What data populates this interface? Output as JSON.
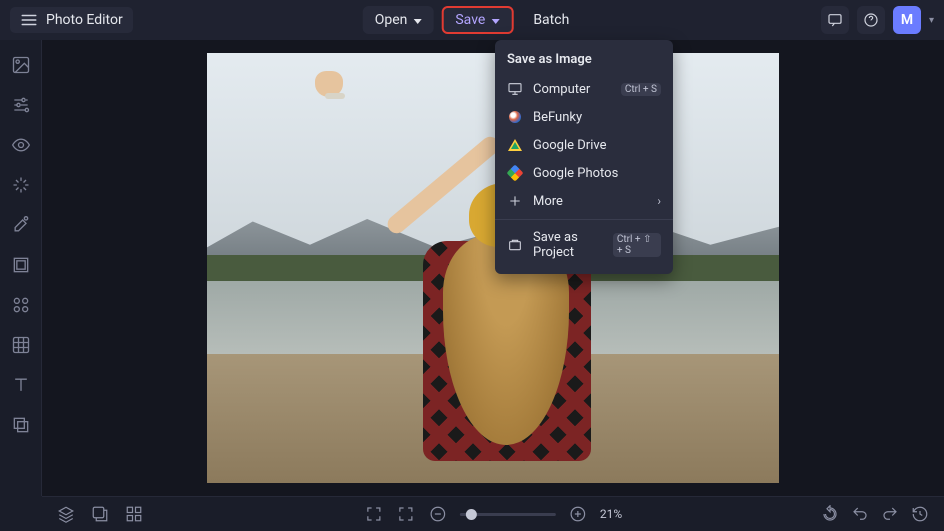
{
  "app_title": "Photo Editor",
  "header": {
    "open": "Open",
    "save": "Save",
    "batch": "Batch",
    "avatar_initial": "M"
  },
  "save_menu": {
    "title": "Save as Image",
    "items": [
      {
        "icon": "computer",
        "label": "Computer",
        "shortcut": "Ctrl + S"
      },
      {
        "icon": "befunky",
        "label": "BeFunky"
      },
      {
        "icon": "gdrive",
        "label": "Google Drive"
      },
      {
        "icon": "gphotos",
        "label": "Google Photos"
      },
      {
        "icon": "more",
        "label": "More",
        "arrow": true
      }
    ],
    "project": {
      "label": "Save as Project",
      "shortcut": "Ctrl + ⇧ + S"
    }
  },
  "zoom_label": "21%"
}
